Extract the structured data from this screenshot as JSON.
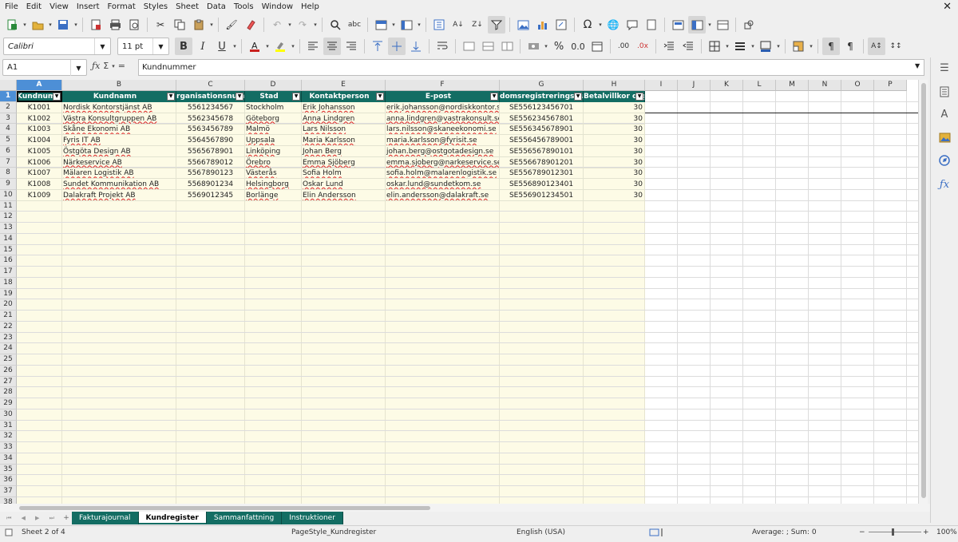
{
  "menu": [
    "File",
    "Edit",
    "View",
    "Insert",
    "Format",
    "Styles",
    "Sheet",
    "Data",
    "Tools",
    "Window",
    "Help"
  ],
  "formatting": {
    "font_name": "Calibri",
    "font_size": "11 pt",
    "bold_glyph": "B",
    "italic_glyph": "I",
    "underline_glyph": "U"
  },
  "formula_bar": {
    "cell_ref": "A1",
    "content": "Kundnummer"
  },
  "columns": [
    "A",
    "B",
    "C",
    "D",
    "E",
    "F",
    "G",
    "H",
    "I",
    "J",
    "K",
    "L",
    "M",
    "N",
    "O",
    "P"
  ],
  "selected_column": "A",
  "selected_row": 1,
  "row_count_visible": 38,
  "table": {
    "headers": [
      "Kundnummer",
      "Kundnamn",
      "Organisationsnummer",
      "Stad",
      "Kontaktperson",
      "E-post",
      "Momsregistreringsnummer",
      "Betalvillkor dagar"
    ],
    "headers_visible": [
      "Kundnumm",
      "Kundnamn",
      "rganisationsnum",
      "Stad",
      "Kontaktperson",
      "E-post",
      "domsregistreringsnum",
      "Betalvillkor dag"
    ],
    "rows": [
      [
        "K1001",
        "Nordisk Kontorstjänst AB",
        "5561234567",
        "Stockholm",
        "Erik Johansson",
        "erik.johansson@nordiskkontor.se",
        "SE556123456701",
        "30"
      ],
      [
        "K1002",
        "Västra Konsultgruppen AB",
        "5562345678",
        "Göteborg",
        "Anna Lindgren",
        "anna.lindgren@vastrakonsult.se",
        "SE556234567801",
        "30"
      ],
      [
        "K1003",
        "Skåne Ekonomi AB",
        "5563456789",
        "Malmö",
        "Lars Nilsson",
        "lars.nilsson@skaneekonomi.se",
        "SE556345678901",
        "30"
      ],
      [
        "K1004",
        "Fyris IT AB",
        "5564567890",
        "Uppsala",
        "Maria Karlsson",
        "maria.karlsson@fyrisit.se",
        "SE556456789001",
        "30"
      ],
      [
        "K1005",
        "Östgöta Design AB",
        "5565678901",
        "Linköping",
        "Johan Berg",
        "johan.berg@ostgotadesign.se",
        "SE556567890101",
        "30"
      ],
      [
        "K1006",
        "Närkeservice AB",
        "5566789012",
        "Örebro",
        "Emma Sjöberg",
        "emma.sjoberg@narkeservice.se",
        "SE556678901201",
        "30"
      ],
      [
        "K1007",
        "Mälaren Logistik AB",
        "5567890123",
        "Västerås",
        "Sofia Holm",
        "sofia.holm@malarenlogistik.se",
        "SE556789012301",
        "30"
      ],
      [
        "K1008",
        "Sundet Kommunikation AB",
        "5568901234",
        "Helsingborg",
        "Oskar Lund",
        "oskar.lund@sundetkom.se",
        "SE556890123401",
        "30"
      ],
      [
        "K1009",
        "Dalakraft Projekt AB",
        "5569012345",
        "Borlänge",
        "Elin Andersson",
        "elin.andersson@dalakraft.se",
        "SE556901234501",
        "30"
      ]
    ]
  },
  "sheet_tabs": [
    "Fakturajournal",
    "Kundregister",
    "Sammanfattning",
    "Instruktioner"
  ],
  "active_tab": "Kundregister",
  "status": {
    "sheet": "Sheet 2 of 4",
    "page_style": "PageStyle_Kundregister",
    "language": "English (USA)",
    "sum": "Average: ; Sum: 0",
    "zoom": "100%"
  },
  "colors": {
    "header_fill": "#136d63",
    "selection": "#4d8fd6",
    "cell_fill": "#fdfbe6"
  }
}
